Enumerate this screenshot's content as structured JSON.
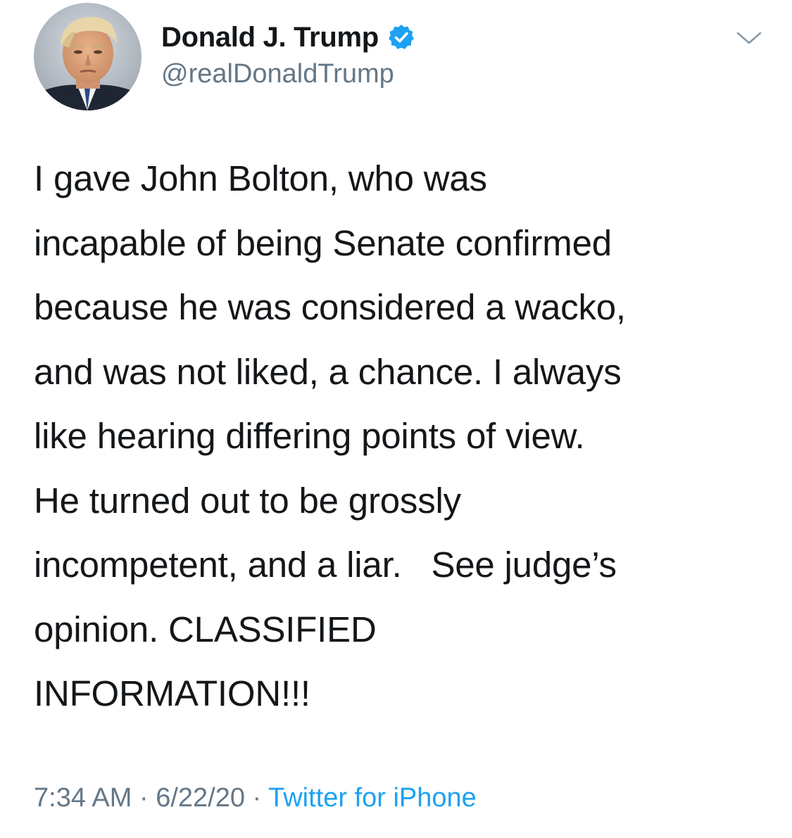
{
  "author": {
    "display_name": "Donald J. Trump",
    "handle": "@realDonaldTrump",
    "verified": true,
    "avatar_icon": "profile-photo"
  },
  "tweet": {
    "lines": [
      "I gave John Bolton, who was",
      "incapable of being Senate confirmed",
      "because he was considered a wacko,",
      "and was not liked, a chance. I always",
      "like hearing differing points of view.",
      "He turned out to be grossly",
      "incompetent, and a liar.   See judge’s",
      "opinion. CLASSIFIED",
      "INFORMATION!!!"
    ]
  },
  "meta": {
    "time": "7:34 AM",
    "separator": " · ",
    "date": "6/22/20",
    "source": "Twitter for iPhone"
  },
  "colors": {
    "text": "#14171a",
    "secondary": "#657786",
    "accent": "#1da1f2",
    "caret": "#8899a6"
  },
  "icons": {
    "verified": "verified-badge-icon",
    "more": "chevron-down-icon"
  }
}
